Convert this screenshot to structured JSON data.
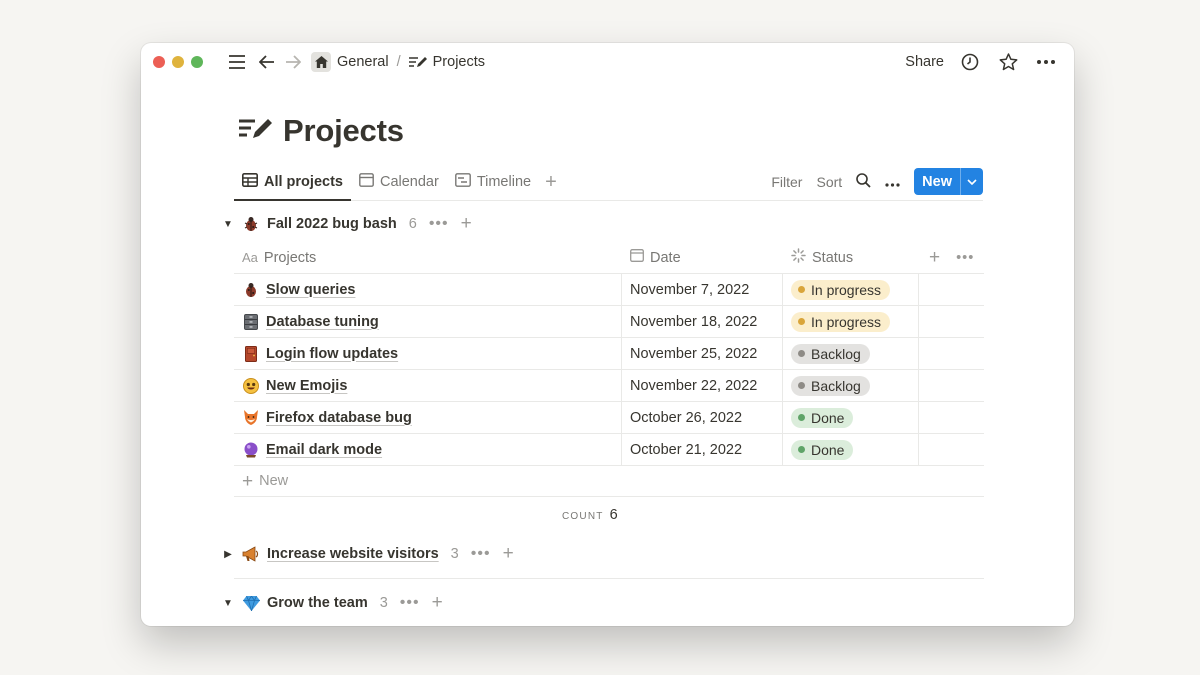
{
  "window": {
    "breadcrumb": {
      "parent": "General",
      "separator": "/",
      "current": "Projects"
    },
    "share_label": "Share"
  },
  "page": {
    "title": "Projects"
  },
  "views": {
    "tabs": [
      {
        "label": "All projects",
        "icon": "table-icon"
      },
      {
        "label": "Calendar",
        "icon": "calendar-icon"
      },
      {
        "label": "Timeline",
        "icon": "timeline-icon"
      }
    ],
    "filter_label": "Filter",
    "sort_label": "Sort",
    "new_label": "New"
  },
  "groups": [
    {
      "name": "Fall 2022 bug bash",
      "emoji": "bug-icon",
      "count": "6",
      "expanded": true
    },
    {
      "name": "Increase website visitors",
      "emoji": "megaphone-icon",
      "count": "3",
      "expanded": false
    },
    {
      "name": "Grow the team",
      "emoji": "gem-icon",
      "count": "3",
      "expanded": true
    }
  ],
  "table": {
    "columns": [
      {
        "label": "Projects",
        "icon": "aa-icon"
      },
      {
        "label": "Date",
        "icon": "calendar-icon"
      },
      {
        "label": "Status",
        "icon": "status-icon"
      }
    ],
    "rows": [
      {
        "name": "Slow queries",
        "emoji": "bug-icon",
        "date": "November 7, 2022",
        "status": "In progress"
      },
      {
        "name": "Database tuning",
        "emoji": "cabinet-icon",
        "date": "November 18, 2022",
        "status": "In progress"
      },
      {
        "name": "Login flow updates",
        "emoji": "door-icon",
        "date": "November 25, 2022",
        "status": "Backlog"
      },
      {
        "name": "New Emojis",
        "emoji": "smile-icon",
        "date": "November 22, 2022",
        "status": "Backlog"
      },
      {
        "name": "Firefox database bug",
        "emoji": "fox-icon",
        "date": "October 26, 2022",
        "status": "Done"
      },
      {
        "name": "Email dark mode",
        "emoji": "crystal-ball-icon",
        "date": "October 21, 2022",
        "status": "Done"
      }
    ],
    "new_row_label": "New",
    "count_label": "COUNT",
    "count_value": "6"
  },
  "status_colors": {
    "In progress": {
      "bg": "#fbeecc",
      "dot": "#d9a53a"
    },
    "Backlog": {
      "bg": "#e3e2e0",
      "dot": "#8e8b86"
    },
    "Done": {
      "bg": "#dbeddb",
      "dot": "#5fa468"
    }
  },
  "accent": "#2383e2"
}
